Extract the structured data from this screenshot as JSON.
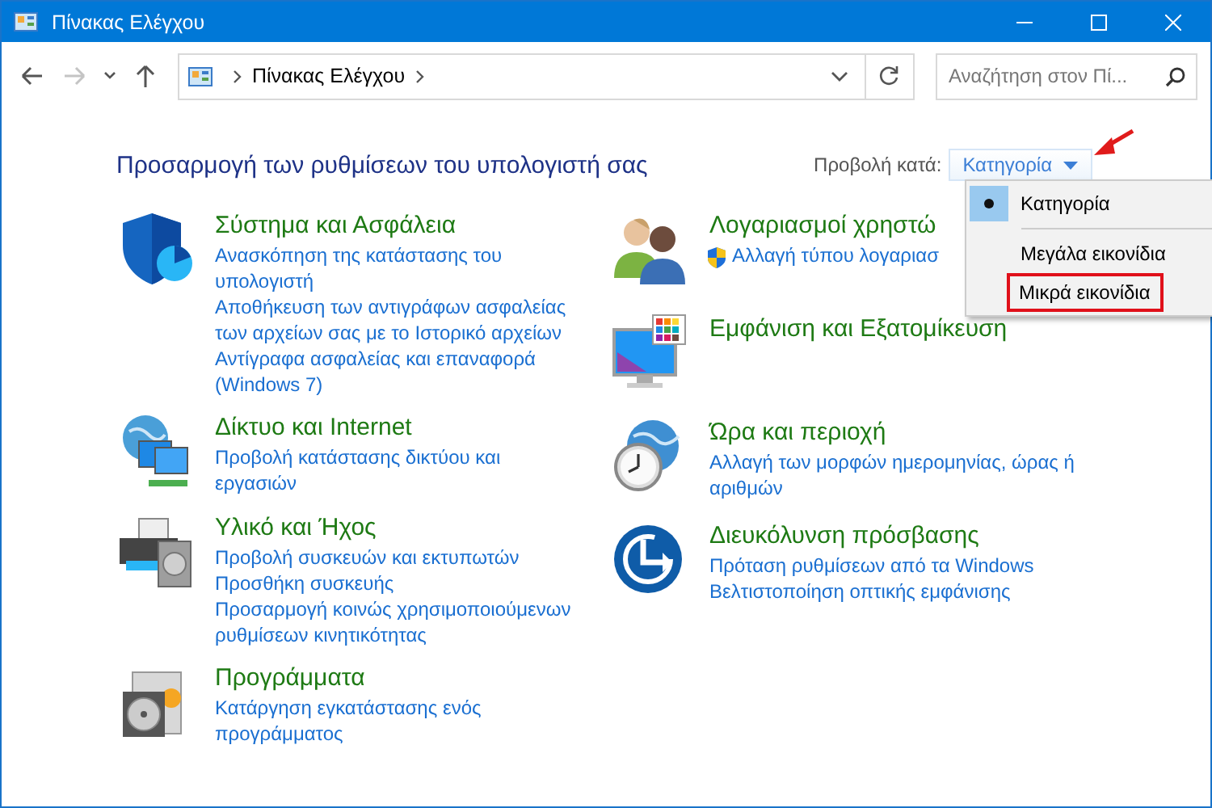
{
  "window": {
    "title": "Πίνακας Ελέγχου"
  },
  "nav_buttons": [
    {
      "kind": "back",
      "disabled": false
    },
    {
      "kind": "forward",
      "disabled": true
    },
    {
      "kind": "recent",
      "disabled": false
    },
    {
      "kind": "up",
      "disabled": false
    }
  ],
  "address_bar": {
    "path": [
      "Πίνακας Ελέγχου"
    ]
  },
  "search": {
    "placeholder": "Αναζήτηση στον Πί..."
  },
  "heading": "Προσαρμογή των ρυθμίσεων του υπολογιστή σας",
  "view_by": {
    "label": "Προβολή κατά:",
    "value": "Κατηγορία",
    "expanded": true,
    "pointed": true
  },
  "view_menu": [
    {
      "label": "Κατηγορία",
      "selected": true,
      "highlighted": false
    },
    {
      "label": "Μεγάλα εικονίδια",
      "selected": false,
      "highlighted": false
    },
    {
      "label": "Μικρά εικονίδια",
      "selected": false,
      "highlighted": true
    }
  ],
  "left_column": [
    {
      "kind": "shield",
      "title": "Σύστημα και Ασφάλεια",
      "links": [
        {
          "text": "Ανασκόπηση της κατάστασης του υπολογιστή",
          "uac": false
        },
        {
          "text": "Αποθήκευση των αντιγράφων ασφαλείας των αρχείων σας με το Ιστορικό αρχείων",
          "uac": false
        },
        {
          "text": "Αντίγραφα ασφαλείας και επαναφορά (Windows 7)",
          "uac": false
        }
      ]
    },
    {
      "kind": "network",
      "title": "Δίκτυο και Internet",
      "links": [
        {
          "text": "Προβολή κατάστασης δικτύου και εργασιών",
          "uac": false
        }
      ]
    },
    {
      "kind": "printer",
      "title": "Υλικό και Ήχος",
      "links": [
        {
          "text": "Προβολή συσκευών και εκτυπωτών",
          "uac": false
        },
        {
          "text": "Προσθήκη συσκευής",
          "uac": false
        },
        {
          "text": "Προσαρμογή κοινώς χρησιμοποιούμενων ρυθμίσεων κινητικότητας",
          "uac": false
        }
      ]
    },
    {
      "kind": "programs",
      "title": "Προγράμματα",
      "links": [
        {
          "text": "Κατάργηση εγκατάστασης ενός προγράμματος",
          "uac": false
        }
      ]
    }
  ],
  "right_column": [
    {
      "kind": "users",
      "title": "Λογαριασμοί χρηστώ",
      "links": [
        {
          "text": "Αλλαγή τύπου λογαριασ",
          "uac": true
        }
      ]
    },
    {
      "kind": "monitor",
      "title": "Εμφάνιση και Εξατομίκευση"
    },
    {
      "kind": "clock",
      "title": "Ώρα και περιοχή",
      "links": [
        {
          "text": "Αλλαγή των μορφών ημερομηνίας, ώρας ή αριθμών",
          "uac": false
        }
      ]
    },
    {
      "kind": "access",
      "title": "Διευκόλυνση πρόσβασης",
      "links": [
        {
          "text": "Πρόταση ρυθμίσεων από τα Windows",
          "uac": false
        },
        {
          "text": "Βελτιστοποίηση οπτικής εμφάνισης",
          "uac": false
        }
      ]
    }
  ]
}
